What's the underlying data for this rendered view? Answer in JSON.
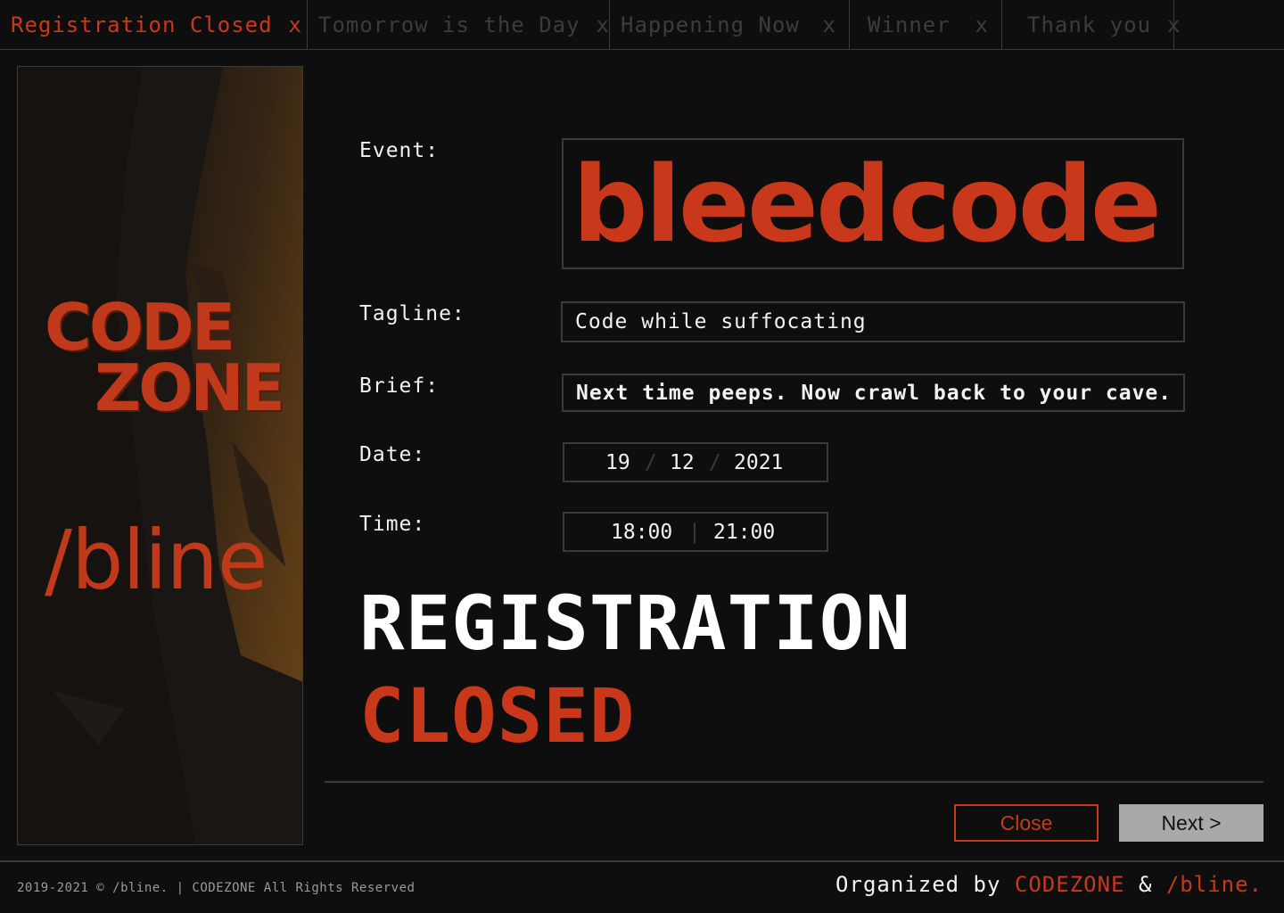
{
  "tabs": [
    {
      "label": "Registration Closed",
      "close": "x",
      "active": true
    },
    {
      "label": "Tomorrow is the Day",
      "close": "x",
      "active": false
    },
    {
      "label": "Happening Now",
      "close": "x",
      "active": false
    },
    {
      "label": "Winner",
      "close": "x",
      "active": false
    },
    {
      "label": "Thank you",
      "close": "x",
      "active": false
    }
  ],
  "poster": {
    "logo_line1": "CODE",
    "logo_line2": "ZONE",
    "brand": "/bline"
  },
  "form": {
    "event_label": "Event:",
    "event_value": "bleedcode",
    "tagline_label": "Tagline:",
    "tagline_value": "Code while suffocating",
    "brief_label": "Brief:",
    "brief_value": "Next time peeps. Now crawl back to your cave.",
    "date_label": "Date:",
    "date": {
      "day": "19",
      "month": "12",
      "year": "2021",
      "separator": "/"
    },
    "time_label": "Time:",
    "time": {
      "start": "18:00",
      "end": "21:00",
      "separator": "|"
    }
  },
  "status": {
    "line1": "REGISTRATION",
    "line2": "CLOSED"
  },
  "buttons": {
    "close": "Close",
    "next": "Next >"
  },
  "footer": {
    "copyright": "2019-2021 © /bline. | CODEZONE All Rights Reserved",
    "organized_prefix": "Organized by",
    "org1": "CODEZONE",
    "amp": "&",
    "org2": "/bline."
  },
  "colors": {
    "accent": "#c9381a",
    "background": "#0e0e0e",
    "border": "#3a3a3a",
    "next_button": "#a9a9a9"
  }
}
